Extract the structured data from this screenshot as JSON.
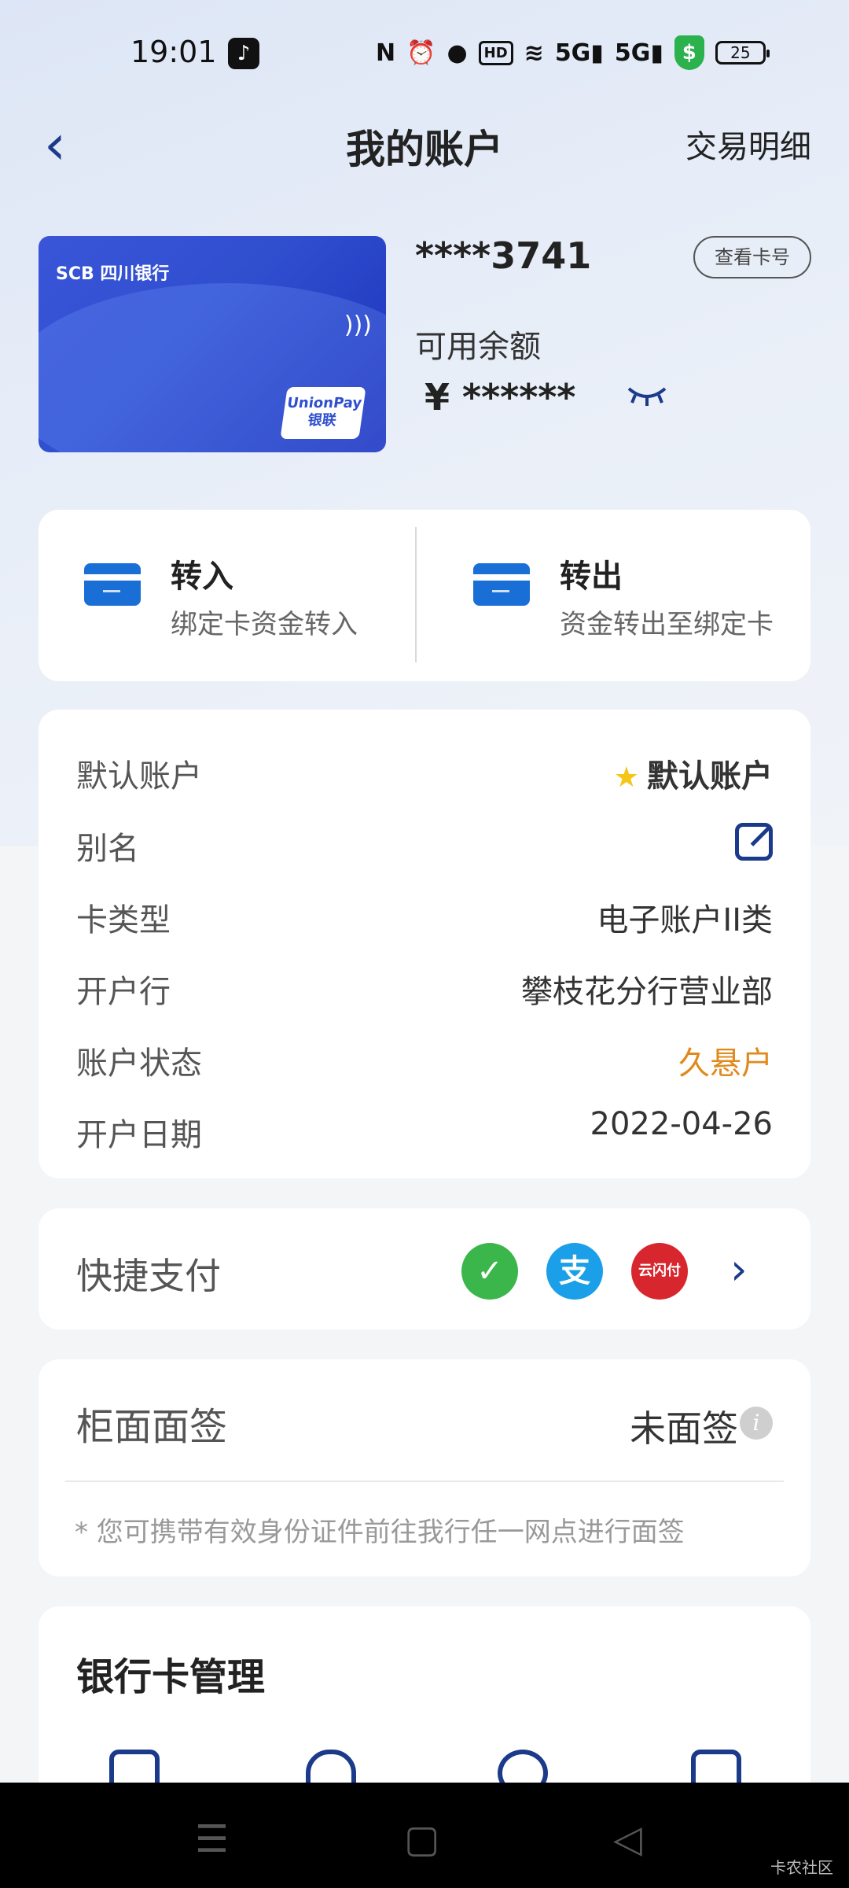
{
  "status_bar": {
    "time": "19:01",
    "battery": "25",
    "icons": [
      "tiktok-icon",
      "nfc-icon",
      "alarm-icon",
      "location-icon",
      "hd-icon",
      "wifi-icon",
      "signal-5g-icon",
      "signal-5g-icon",
      "shield-icon",
      "battery-icon"
    ]
  },
  "header": {
    "title": "我的账户",
    "right_link": "交易明细"
  },
  "card": {
    "bank_brand": "SCB 四川银行",
    "unionpay": "UnionPay 银联",
    "number_masked": "****3741",
    "view_card_label": "查看卡号",
    "balance_label": "可用余额",
    "balance_value": "¥ ******"
  },
  "transfer": {
    "in": {
      "title": "转入",
      "subtitle": "绑定卡资金转入"
    },
    "out": {
      "title": "转出",
      "subtitle": "资金转出至绑定卡"
    }
  },
  "account_info": {
    "rows": [
      {
        "label": "默认账户",
        "value": "默认账户"
      },
      {
        "label": "别名",
        "value": ""
      },
      {
        "label": "卡类型",
        "value": "电子账户II类"
      },
      {
        "label": "开户行",
        "value": "攀枝花分行营业部"
      },
      {
        "label": "账户状态",
        "value": "久悬户"
      },
      {
        "label": "开户日期",
        "value": "2022-04-26"
      }
    ],
    "status_color": "#e08a1e"
  },
  "quick_pay": {
    "label": "快捷支付",
    "methods": [
      {
        "icon": "wechat-pay-icon",
        "glyph": "✓",
        "color": "#3bb64a"
      },
      {
        "icon": "alipay-icon",
        "glyph": "支",
        "color": "#1a9fe8"
      },
      {
        "icon": "unionpay-cloud-icon",
        "glyph": "云闪付",
        "color": "#d8262e"
      }
    ]
  },
  "counter_sign": {
    "label": "柜面面签",
    "value": "未面签",
    "note": "* 您可携带有效身份证件前往我行任一网点进行面签"
  },
  "card_management": {
    "title": "银行卡管理"
  },
  "nav": {
    "menu": "☰",
    "home": "▢",
    "back": "◁",
    "watermark": "卡农社区"
  },
  "colors": {
    "accent": "#1b3a8a",
    "card_blue": "#2f4fcf"
  }
}
